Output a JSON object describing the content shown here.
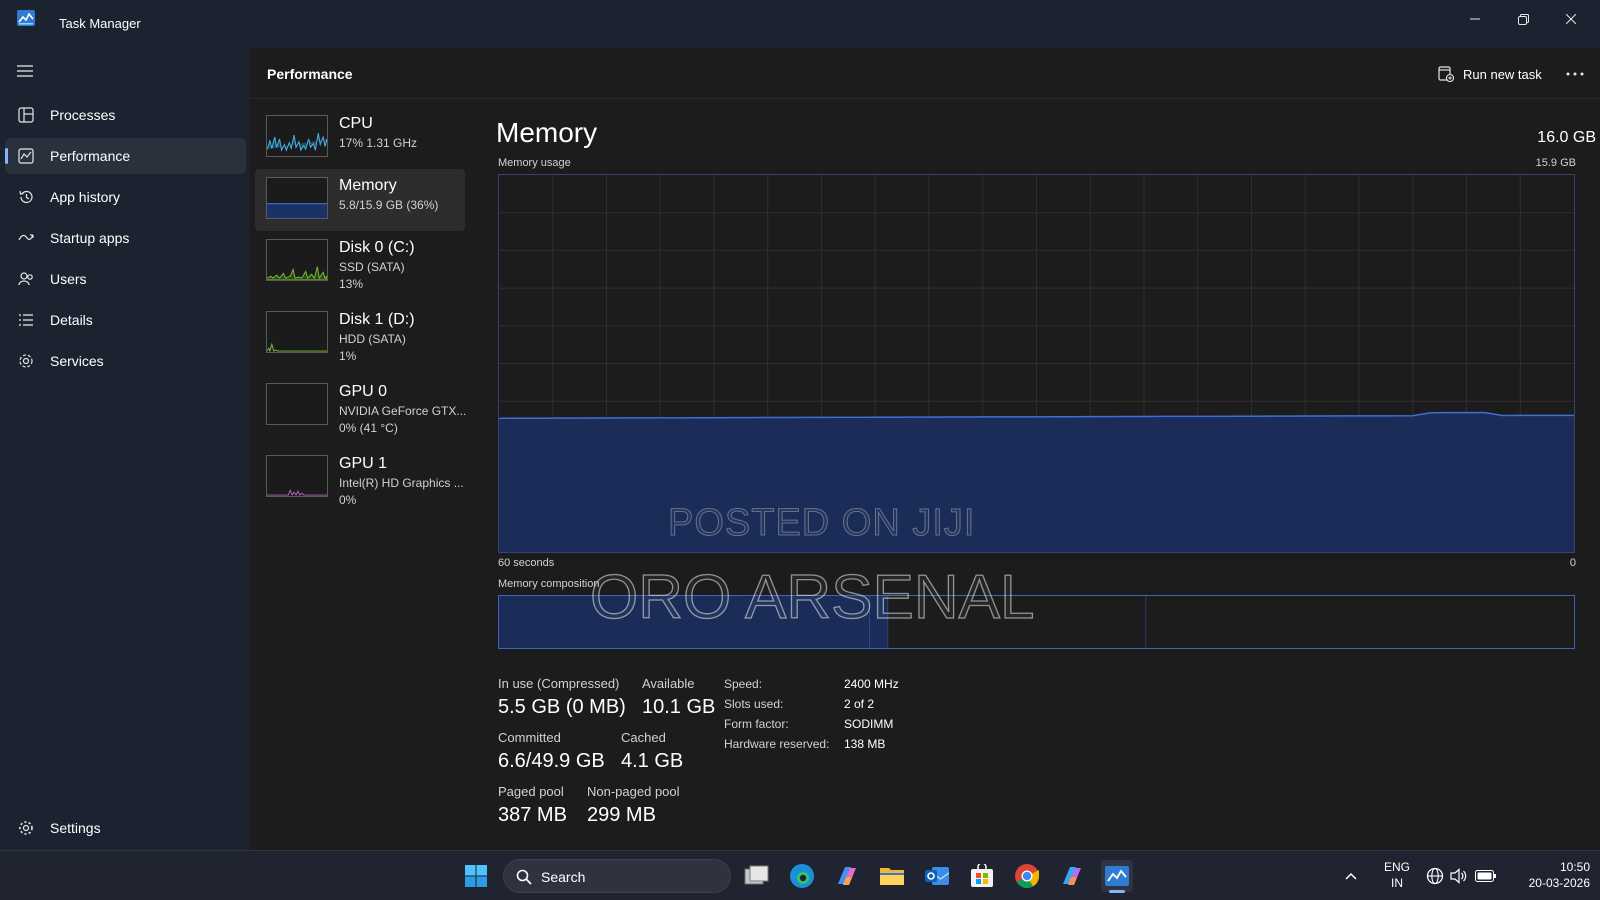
{
  "window": {
    "title": "Task Manager",
    "icons": {
      "logo": "task-manager-logo-icon",
      "minimize": "minimize-icon",
      "maximize": "restore-icon",
      "close": "close-icon"
    }
  },
  "sidebar": {
    "items": [
      {
        "label": "Processes",
        "icon": "processes-icon"
      },
      {
        "label": "Performance",
        "icon": "performance-icon",
        "active": true
      },
      {
        "label": "App history",
        "icon": "app-history-icon"
      },
      {
        "label": "Startup apps",
        "icon": "startup-apps-icon"
      },
      {
        "label": "Users",
        "icon": "users-icon"
      },
      {
        "label": "Details",
        "icon": "details-icon"
      },
      {
        "label": "Services",
        "icon": "services-icon"
      }
    ],
    "settings_label": "Settings"
  },
  "header": {
    "title": "Performance",
    "run_new_task": "Run new task",
    "more_icon": "ellipsis-icon"
  },
  "devices": [
    {
      "name": "CPU",
      "line1": "17%  1.31 GHz",
      "line2": "",
      "color": "#4fb3e8"
    },
    {
      "name": "Memory",
      "line1": "5.8/15.9 GB (36%)",
      "line2": "",
      "color": "#3f6fd6",
      "active": true
    },
    {
      "name": "Disk 0 (C:)",
      "line1": "SSD (SATA)",
      "line2": "13%",
      "color": "#7dbb3f"
    },
    {
      "name": "Disk 1 (D:)",
      "line1": "HDD (SATA)",
      "line2": "1%",
      "color": "#7dbb3f"
    },
    {
      "name": "GPU 0",
      "line1": "NVIDIA GeForce GTX...",
      "line2": "0% (41 °C)",
      "color": "#b85cc0"
    },
    {
      "name": "GPU 1",
      "line1": "Intel(R) HD Graphics ...",
      "line2": "0%",
      "color": "#b85cc0"
    }
  ],
  "memory": {
    "title": "Memory",
    "total": "16.0 GB",
    "usage_label": "Memory usage",
    "usage_max": "15.9 GB",
    "time_left": "60 seconds",
    "time_right": "0",
    "composition_label": "Memory composition",
    "usage_fraction": 0.36,
    "composition": {
      "in_use": 0.345,
      "modified": 0.017,
      "standby": 0.24,
      "free": 0.398
    },
    "stats": {
      "in_use_label": "In use (Compressed)",
      "in_use_value": "5.5 GB (0 MB)",
      "available_label": "Available",
      "available_value": "10.1 GB",
      "committed_label": "Committed",
      "committed_value": "6.6/49.9 GB",
      "cached_label": "Cached",
      "cached_value": "4.1 GB",
      "paged_label": "Paged pool",
      "paged_value": "387 MB",
      "nonpaged_label": "Non-paged pool",
      "nonpaged_value": "299 MB"
    },
    "specs": [
      {
        "label": "Speed:",
        "value": "2400 MHz"
      },
      {
        "label": "Slots used:",
        "value": "2 of 2"
      },
      {
        "label": "Form factor:",
        "value": "SODIMM"
      },
      {
        "label": "Hardware reserved:",
        "value": "138 MB"
      }
    ]
  },
  "watermark": {
    "line1": "POSTED ON JIJI",
    "line2": "ORO ARSENAL"
  },
  "taskbar": {
    "search_label": "Search",
    "apps": [
      "windows-start-icon",
      "task-view-icon",
      "edge-browser-icon",
      "copilot-icon",
      "file-explorer-icon",
      "outlook-icon",
      "microsoft-store-icon",
      "chrome-icon",
      "copilot-pc-icon",
      "task-manager-icon"
    ],
    "language": "ENG",
    "region": "IN",
    "time": "10:50",
    "date": "20-03-2026"
  }
}
